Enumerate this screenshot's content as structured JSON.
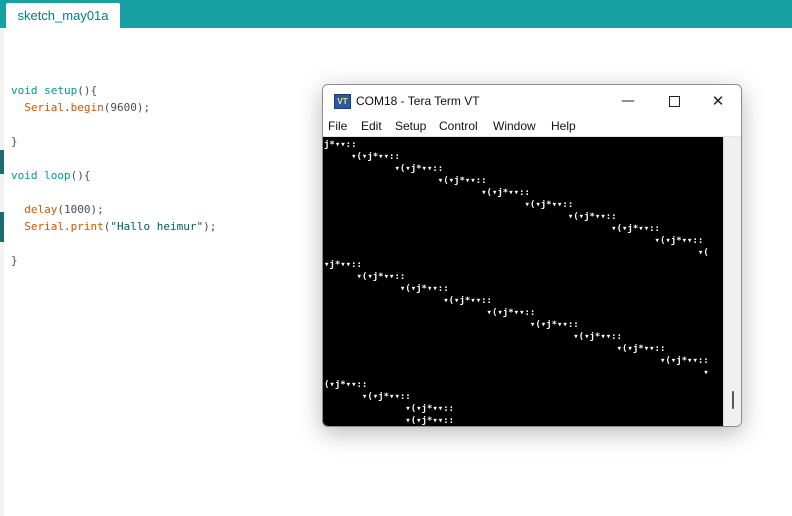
{
  "ide": {
    "tab_label": "sketch_may01a",
    "code": [
      [
        {
          "t": "void",
          "c": "kw"
        },
        {
          "t": " "
        },
        {
          "t": "setup",
          "c": "kw"
        },
        {
          "t": "(){"
        }
      ],
      [
        {
          "t": "  "
        },
        {
          "t": "Serial",
          "c": "fn"
        },
        {
          "t": "."
        },
        {
          "t": "begin",
          "c": "fn"
        },
        {
          "t": "(9600);"
        }
      ],
      [],
      [
        {
          "t": "}"
        }
      ],
      [],
      [
        {
          "t": "void",
          "c": "kw"
        },
        {
          "t": " "
        },
        {
          "t": "loop",
          "c": "kw"
        },
        {
          "t": "(){"
        }
      ],
      [],
      [
        {
          "t": "  "
        },
        {
          "t": "delay",
          "c": "fn"
        },
        {
          "t": "(1000);"
        }
      ],
      [
        {
          "t": "  "
        },
        {
          "t": "Serial",
          "c": "fn"
        },
        {
          "t": "."
        },
        {
          "t": "print",
          "c": "fn"
        },
        {
          "t": "("
        },
        {
          "t": "\"Hallo heimur\"",
          "c": "str"
        },
        {
          "t": ");"
        }
      ],
      [],
      [
        {
          "t": "}"
        }
      ]
    ]
  },
  "terminal": {
    "title": "COM18 - Tera Term VT",
    "logo_text": "VT",
    "icons": {
      "app": "teraterm-logo-icon",
      "minimize": "minimize-icon",
      "maximize": "maximize-icon",
      "close": "close-icon"
    },
    "controls": {
      "minimize": "—",
      "close": "✕"
    },
    "menu": [
      "File",
      "Edit",
      "Setup",
      "Control",
      "Window",
      "Help"
    ],
    "output_lines": [
      "j*▾▾::",
      "     ▾(▾j*▾▾::",
      "             ▾(▾j*▾▾::",
      "                     ▾(▾j*▾▾::",
      "                             ▾(▾j*▾▾::",
      "                                     ▾(▾j*▾▾::",
      "                                             ▾(▾j*▾▾::",
      "                                                     ▾(▾j*▾▾::",
      "                                                             ▾(▾j*▾▾::",
      "                                                                     ▾(",
      "▾j*▾▾::",
      "      ▾(▾j*▾▾::",
      "              ▾(▾j*▾▾::",
      "                      ▾(▾j*▾▾::",
      "                              ▾(▾j*▾▾::",
      "                                      ▾(▾j*▾▾::",
      "                                              ▾(▾j*▾▾::",
      "                                                      ▾(▾j*▾▾::",
      "                                                              ▾(▾j*▾▾::",
      "                                                                      ▾",
      "(▾j*▾▾::",
      "       ▾(▾j*▾▾::",
      "               ▾(▾j*▾▾::",
      "               ▾(▾j*▾▾::"
    ]
  }
}
